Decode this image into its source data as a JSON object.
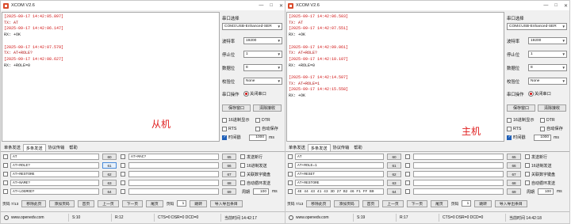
{
  "windows": [
    {
      "id": "left",
      "title": "XCOM V2.6",
      "receive_lines": [
        {
          "kind": "ts",
          "text": "[2025-09-17 14:42:05.897]"
        },
        {
          "kind": "tx",
          "text": "TX: AT"
        },
        {
          "kind": "ts",
          "text": "[2025-09-17 14:42:06.147]"
        },
        {
          "kind": "rx",
          "text": "RX: +OK"
        },
        {
          "kind": "gap",
          "text": ""
        },
        {
          "kind": "ts",
          "text": "[2025-09-17 14:42:07.579]"
        },
        {
          "kind": "tx",
          "text": "TX: AT+ROLE?"
        },
        {
          "kind": "ts",
          "text": "[2025-09-17 14:42:08.627]"
        },
        {
          "kind": "rx",
          "text": "RX: +ROLE=0"
        }
      ],
      "watermark": "从机",
      "side": {
        "port_label": "串口选择",
        "port_value": "COM3:USB-Enhanced-SER",
        "baud_label": "波特率",
        "baud_value": "19200",
        "stop_label": "停止位",
        "stop_value": "1",
        "data_label": "数据位",
        "data_value": "8",
        "parity_label": "校验位",
        "parity_value": "None",
        "op_label": "串口操作",
        "close_label": "关闭串口",
        "save_label": "保存窗口",
        "clear_label": "清除接收",
        "hex_label": "16进制显示",
        "dtr_label": "DTR",
        "rts_label": "RTS",
        "autosave_label": "自动保存",
        "timestamp_label": "时间戳",
        "timestamp_value": "1000",
        "ms_label": "ms"
      },
      "tabs": [
        "单条发送",
        "多条发送",
        "协议传输",
        "帮助"
      ],
      "active_tab": 1,
      "multi_rows": [
        {
          "text": "AT",
          "num": "60",
          "num2": "",
          "field2": "AT+MAC?",
          "num3": "65"
        },
        {
          "text": "AT+ROLE?",
          "num": "61",
          "num2": "",
          "field2": "",
          "num3": "66"
        },
        {
          "text": "AT+RESTORE",
          "num": "62",
          "num2": "",
          "field2": "",
          "num3": "67"
        },
        {
          "text": "AT+NAME?",
          "num": "63",
          "num2": "",
          "field2": "",
          "num3": "68"
        },
        {
          "text": "AT+LOGMOD?",
          "num": "64",
          "num2": "",
          "field2": "",
          "num3": "69"
        }
      ],
      "options": {
        "newline": "发送新行",
        "hex_send": "16进制发送",
        "link_keyboard": "关联数字键盘",
        "auto_loop": "自动循环发送",
        "period_label": "周期",
        "period_value": "100",
        "period_unit": "ms"
      },
      "pager": {
        "page_label": "页码 7/13",
        "remove_label": "移除此页",
        "add_label": "添加页码",
        "first_label": "首页",
        "prev_label": "上一页",
        "next_label": "下一页",
        "last_label": "尾页",
        "page_input_label": "页码",
        "page_input_value": "1",
        "jump_label": "跳转",
        "import_label": "导入导出条目"
      },
      "status": {
        "url": "www.openedv.com",
        "sent": "S:10",
        "recv": "R:12",
        "signals": "CTS=0 DSR=0 DCD=0",
        "time": "当前时间 14:42:17"
      }
    },
    {
      "id": "right",
      "title": "XCOM V2.6",
      "receive_lines": [
        {
          "kind": "ts",
          "text": "[2025-09-17 14:42:06.503]"
        },
        {
          "kind": "tx",
          "text": "TX: AT"
        },
        {
          "kind": "ts",
          "text": "[2025-09-17 14:42:07.551]"
        },
        {
          "kind": "rx",
          "text": "RX: +OK"
        },
        {
          "kind": "gap",
          "text": ""
        },
        {
          "kind": "ts",
          "text": "[2025-09-17 14:42:09.061]"
        },
        {
          "kind": "tx",
          "text": "TX: AT+ROLE?"
        },
        {
          "kind": "ts",
          "text": "[2025-09-17 14:42:10.107]"
        },
        {
          "kind": "rx",
          "text": "RX: +ROLE=0"
        },
        {
          "kind": "gap",
          "text": ""
        },
        {
          "kind": "ts",
          "text": "[2025-09-17 14:42:14.507]"
        },
        {
          "kind": "tx",
          "text": "TX: AT+ROLE=1"
        },
        {
          "kind": "ts",
          "text": "[2025-09-17 14:42:15.558]"
        },
        {
          "kind": "rx",
          "text": "RX: +OK"
        }
      ],
      "watermark": "主机",
      "side": {
        "port_label": "串口选择",
        "port_value": "COM4:USB-Enhanced-SER",
        "baud_label": "波特率",
        "baud_value": "19200",
        "stop_label": "停止位",
        "stop_value": "1",
        "data_label": "数据位",
        "data_value": "8",
        "parity_label": "校验位",
        "parity_value": "None",
        "op_label": "串口操作",
        "close_label": "关闭串口",
        "save_label": "保存窗口",
        "clear_label": "清除接收",
        "hex_label": "16进制显示",
        "dtr_label": "DTR",
        "rts_label": "RTS",
        "autosave_label": "自动保存",
        "timestamp_label": "时间戳",
        "timestamp_value": "1000",
        "ms_label": "ms"
      },
      "tabs": [
        "单条发送",
        "多条发送",
        "协议传输",
        "帮助"
      ],
      "active_tab": 1,
      "multi_rows": [
        {
          "text": "AT",
          "num": "60",
          "num2": "",
          "field2": "",
          "num3": "65"
        },
        {
          "text": "AT+ROLE=1",
          "num": "61",
          "num2": "",
          "field2": "",
          "num3": "66"
        },
        {
          "text": "AT+RESET",
          "num": "62",
          "num2": "",
          "field2": "",
          "num3": "67"
        },
        {
          "text": "AT+RESTORE",
          "num": "63",
          "num2": "",
          "field2": "",
          "num3": "68"
        },
        {
          "text": "4E 44 43 41 43 3D 27 B2 46 F1 FF B0",
          "num": "64",
          "num2": "",
          "field2": "",
          "num3": "69"
        }
      ],
      "options": {
        "newline": "发送新行",
        "hex_send": "16进制发送",
        "link_keyboard": "关联数字键盘",
        "auto_loop": "自动循环发送",
        "period_label": "周期",
        "period_value": "100",
        "period_unit": "ms"
      },
      "pager": {
        "page_label": "页码 7/13",
        "remove_label": "移除此页",
        "add_label": "添加页码",
        "first_label": "首页",
        "prev_label": "上一页",
        "next_label": "下一页",
        "last_label": "尾页",
        "page_input_label": "页码",
        "page_input_value": "1",
        "jump_label": "跳转",
        "import_label": "导入导出条目"
      },
      "status": {
        "url": "www.openedv.com",
        "sent": "S:19",
        "recv": "R:17",
        "signals": "CTS=0 DSR=0 DCD=0",
        "time": "当前时间 14:42:18"
      }
    }
  ],
  "colors": {
    "timestamp": "#d01010",
    "watermark": "#e02020",
    "radio_active": "#d01010"
  },
  "icons": {
    "app": "xcom-app-icon",
    "status": "gear-icon"
  }
}
